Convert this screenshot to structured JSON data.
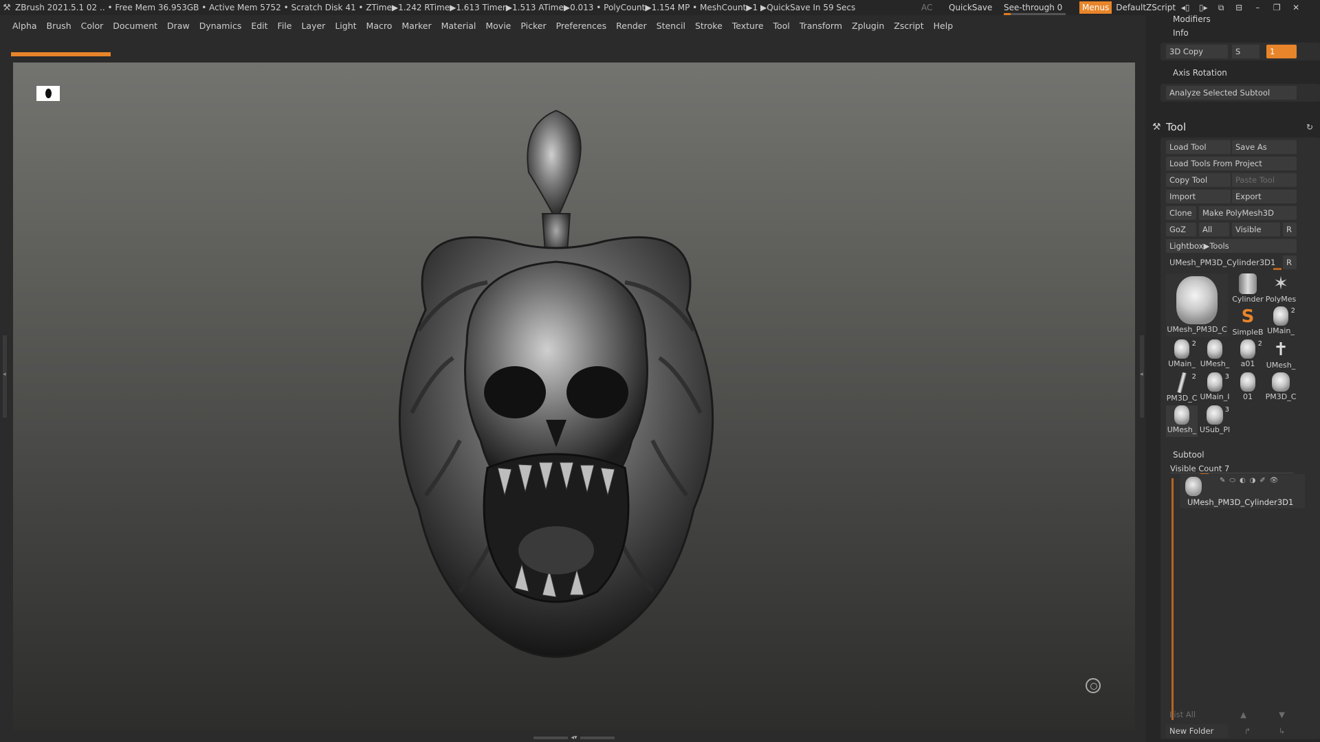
{
  "titlebar": {
    "status": "ZBrush 2021.5.1    02   .. • Free Mem 36.953GB • Active Mem 5752 • Scratch Disk 41 •  ZTime▶1.242 RTime▶1.613 Timer▶1.513 ATime▶0.013 • PolyCount▶1.154 MP  • MeshCount▶1   ▶QuickSave In 59 Secs",
    "ac": "AC",
    "quicksave": "QuickSave",
    "see_through": "See-through  0",
    "menus": "Menus",
    "script": "DefaultZScript"
  },
  "menubar": [
    "Alpha",
    "Brush",
    "Color",
    "Document",
    "Draw",
    "Dynamics",
    "Edit",
    "File",
    "Layer",
    "Light",
    "Macro",
    "Marker",
    "Material",
    "Movie",
    "Picker",
    "Preferences",
    "Render",
    "Stencil",
    "Stroke",
    "Texture",
    "Tool",
    "Transform",
    "Zplugin",
    "Zscript",
    "Help"
  ],
  "panel": {
    "modifiers": "Modifiers",
    "info": "Info",
    "copy3d": "3D Copy",
    "s_label": "S",
    "s_value": "1",
    "axis_rotation": "Axis Rotation",
    "analyze": "Analyze Selected Subtool",
    "tool_title": "Tool",
    "load_tool": "Load Tool",
    "save_as": "Save As",
    "load_from_project": "Load Tools From Project",
    "copy_tool": "Copy Tool",
    "paste_tool": "Paste Tool",
    "import": "Import",
    "export": "Export",
    "clone": "Clone",
    "make_polymesh": "Make PolyMesh3D",
    "goz": "GoZ",
    "all": "All",
    "visible": "Visible",
    "r": "R",
    "lightbox_tools": "Lightbox▶Tools",
    "current_tool": "UMesh_PM3D_Cylinder3D1",
    "thumbs": [
      {
        "label": "UMesh_PM3D_C",
        "badge": ""
      },
      {
        "label": "Cylinder",
        "badge": ""
      },
      {
        "label": "PolyMes",
        "badge": ""
      },
      {
        "label": "SimpleB",
        "badge": ""
      },
      {
        "label": "UMain_",
        "badge": "2"
      },
      {
        "label": "UMain_",
        "badge": "2"
      },
      {
        "label": "UMesh_",
        "badge": ""
      },
      {
        "label": "a01",
        "badge": "2"
      },
      {
        "label": "UMesh_",
        "badge": ""
      },
      {
        "label": "PM3D_C",
        "badge": "2"
      },
      {
        "label": "UMain_I",
        "badge": "3"
      },
      {
        "label": "01",
        "badge": ""
      },
      {
        "label": "PM3D_C",
        "badge": ""
      },
      {
        "label": "UMesh_",
        "badge": ""
      },
      {
        "label": "USub_Pl",
        "badge": "3"
      }
    ],
    "subtool_title": "Subtool",
    "visible_count": "Visible Count 7",
    "subtool_name": "UMesh_PM3D_Cylinder3D1",
    "list_all": "List All",
    "new_folder": "New Folder"
  }
}
